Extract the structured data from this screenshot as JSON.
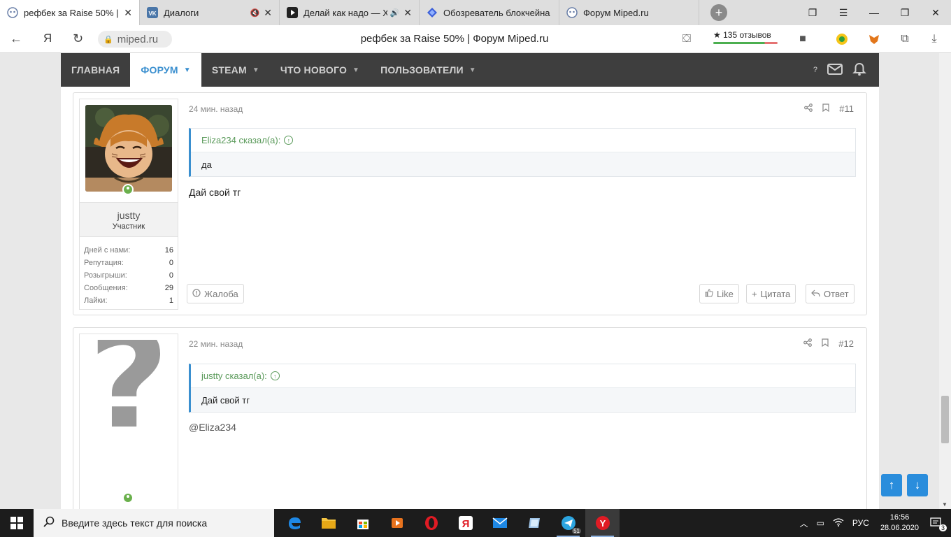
{
  "browser": {
    "tabs": [
      {
        "title": "рефбек за Raise 50% | ф",
        "icon": "miped-icon",
        "active": true,
        "close": "✕"
      },
      {
        "title": "Диалоги",
        "icon": "vk-icon",
        "active": false,
        "close": "✕",
        "mute": "🔇"
      },
      {
        "title": "Делай как надо — Х",
        "icon": "play-icon",
        "active": false,
        "close": "✕",
        "mute": "🔊"
      },
      {
        "title": "Обозреватель блокчейна",
        "icon": "blockchain-icon",
        "active": false
      },
      {
        "title": "Форум Miped.ru",
        "icon": "miped-icon",
        "active": false
      }
    ],
    "new_tab": "+",
    "address": "miped.ru",
    "page_title": "рефбек за Raise 50% | Форум Miped.ru",
    "reviews": "★ 135 отзывов",
    "back": "←",
    "yandex": "Я",
    "reload": "↻"
  },
  "site": {
    "nav": [
      {
        "label": "ГЛАВНАЯ",
        "caret": false,
        "active": false
      },
      {
        "label": "ФОРУМ",
        "caret": true,
        "active": true
      },
      {
        "label": "STEAM",
        "caret": true,
        "active": false
      },
      {
        "label": "ЧТО НОВОГО",
        "caret": true,
        "active": false
      },
      {
        "label": "ПОЛЬЗОВАТЕЛИ",
        "caret": true,
        "active": false
      }
    ],
    "nav_help": "?"
  },
  "posts": [
    {
      "time": "24 мин. назад",
      "number": "#11",
      "user": {
        "name": "justty",
        "role": "Участник"
      },
      "stats": [
        {
          "label": "Дней с нами:",
          "value": "16"
        },
        {
          "label": "Репутация:",
          "value": "0"
        },
        {
          "label": "Розыгрыши:",
          "value": "0"
        },
        {
          "label": "Сообщения:",
          "value": "29"
        },
        {
          "label": "Лайки:",
          "value": "1"
        }
      ],
      "quote_author": "Eliza234 сказал(а):",
      "quote_text": "да",
      "message": "Дай свой тг",
      "report": "Жалоба",
      "like": "Like",
      "cite": "Цитата",
      "reply": "Ответ"
    },
    {
      "time": "22 мин. назад",
      "number": "#12",
      "avatar_glyph": "?",
      "quote_author": "justty сказал(а):",
      "quote_text": "Дай свой тг",
      "message": "@Eliza234"
    }
  ],
  "scroll": {
    "up": "↑",
    "down": "↓"
  },
  "taskbar": {
    "search_placeholder": "Введите здесь текст для поиска",
    "lang": "РУС",
    "time": "16:56",
    "date": "28.06.2020",
    "notifications": "3",
    "telegram_badge": "51"
  }
}
